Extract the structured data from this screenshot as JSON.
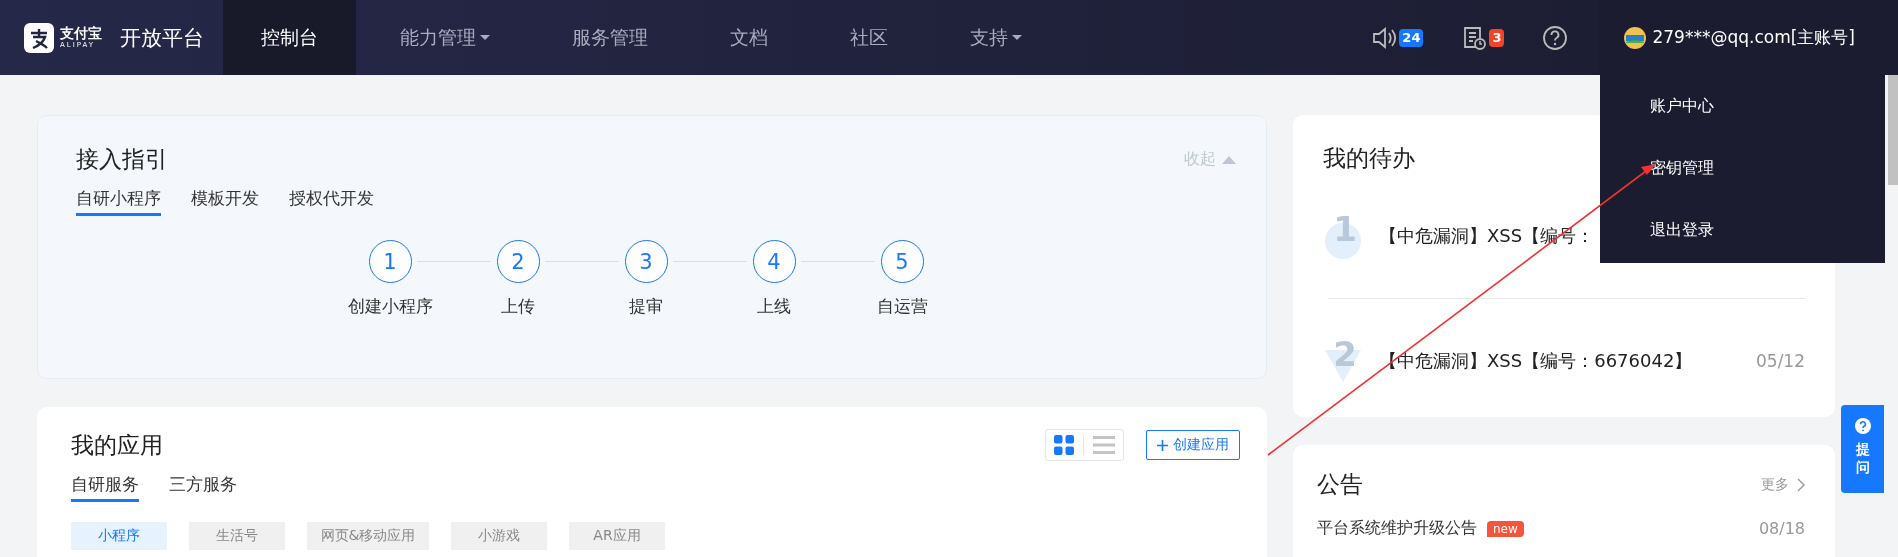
{
  "header": {
    "logo_text": "支付宝",
    "logo_sub": "ALIPAY",
    "platform": "开放平台",
    "nav": [
      {
        "label": "控制台",
        "selected": true,
        "dropdown": false
      },
      {
        "label": "能力管理",
        "selected": false,
        "dropdown": true
      },
      {
        "label": "服务管理",
        "selected": false,
        "dropdown": false
      },
      {
        "label": "文档",
        "selected": false,
        "dropdown": false
      },
      {
        "label": "社区",
        "selected": false,
        "dropdown": false
      },
      {
        "label": "支持",
        "selected": false,
        "dropdown": true
      }
    ],
    "notifications": {
      "count": "24"
    },
    "tasks": {
      "count": "3"
    },
    "user": {
      "account": "279***@qq.com[主账号]"
    }
  },
  "user_menu": {
    "items": [
      {
        "label": "账户中心"
      },
      {
        "label": "密钥管理"
      },
      {
        "label": "退出登录"
      }
    ]
  },
  "guide": {
    "title": "接入指引",
    "collapse": "收起",
    "tabs": [
      {
        "label": "自研小程序",
        "selected": true
      },
      {
        "label": "模板开发",
        "selected": false
      },
      {
        "label": "授权代开发",
        "selected": false
      }
    ],
    "steps": [
      {
        "number": "1",
        "label": "创建小程序"
      },
      {
        "number": "2",
        "label": "上传"
      },
      {
        "number": "3",
        "label": "提审"
      },
      {
        "number": "4",
        "label": "上线"
      },
      {
        "number": "5",
        "label": "自运营"
      }
    ]
  },
  "apps": {
    "title": "我的应用",
    "views": [
      {
        "kind": "grid",
        "selected": true
      },
      {
        "kind": "list",
        "selected": false
      }
    ],
    "create": "创建应用",
    "tabs": [
      {
        "label": "自研服务",
        "selected": true
      },
      {
        "label": "三方服务",
        "selected": false
      }
    ],
    "filters": [
      {
        "label": "小程序",
        "selected": true
      },
      {
        "label": "生活号",
        "selected": false
      },
      {
        "label": "网页&移动应用",
        "selected": false
      },
      {
        "label": "小游戏",
        "selected": false
      },
      {
        "label": "AR应用",
        "selected": false
      }
    ]
  },
  "todo": {
    "title": "我的待办",
    "items": [
      {
        "rank": "1",
        "kind": "circle",
        "text": "【中危漏洞】XSS【编号："
      },
      {
        "rank": "2",
        "kind": "triangle",
        "text": "【中危漏洞】XSS【编号：6676042】",
        "date": "05/12"
      }
    ]
  },
  "notice": {
    "title": "公告",
    "more": "更多",
    "items": [
      {
        "text": "平台系统维护升级公告",
        "new": "new",
        "date": "08/18"
      }
    ]
  },
  "ask": {
    "label": "提问"
  }
}
